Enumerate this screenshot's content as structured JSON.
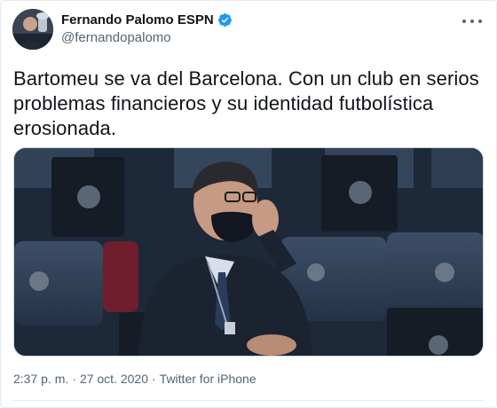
{
  "author": {
    "display_name": "Fernando Palomo ESPN",
    "handle": "@fernandopalomo",
    "verified": true
  },
  "tweet": {
    "text": "Bartomeu se va del Barcelona. Con un club en serios problemas financieros y su identidad futbolística erosionada."
  },
  "meta": {
    "time": "2:37 p. m.",
    "separator": "·",
    "date": "27 oct. 2020",
    "separator2": "·",
    "source": "Twitter for iPhone"
  },
  "colors": {
    "accent": "#1d9bf0",
    "text": "#0f1419",
    "secondary": "#536471"
  },
  "icons": {
    "verified": "verified-badge-icon",
    "more": "more-options-icon"
  }
}
